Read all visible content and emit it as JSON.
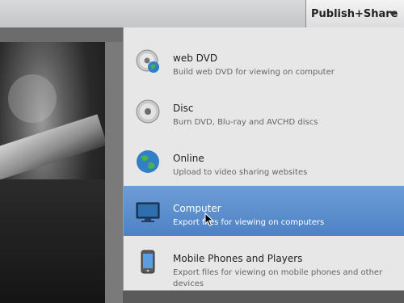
{
  "toolbar": {
    "publish_label": "Publish+Share"
  },
  "menu": {
    "items": [
      {
        "title": "web DVD",
        "desc": "Build web DVD for viewing on computer",
        "icon": "disc-globe-icon"
      },
      {
        "title": "Disc",
        "desc": "Burn DVD, Blu-ray and AVCHD discs",
        "icon": "disc-icon"
      },
      {
        "title": "Online",
        "desc": "Upload to video sharing websites",
        "icon": "globe-icon"
      },
      {
        "title": "Computer",
        "desc": "Export files for viewing on computers",
        "icon": "monitor-icon",
        "selected": true
      },
      {
        "title": "Mobile Phones and Players",
        "desc": "Export files for viewing on mobile phones and other devices",
        "icon": "phone-icon"
      }
    ]
  },
  "colors": {
    "selected": "#5a8ccc",
    "menu_bg": "#e7e7e8"
  }
}
